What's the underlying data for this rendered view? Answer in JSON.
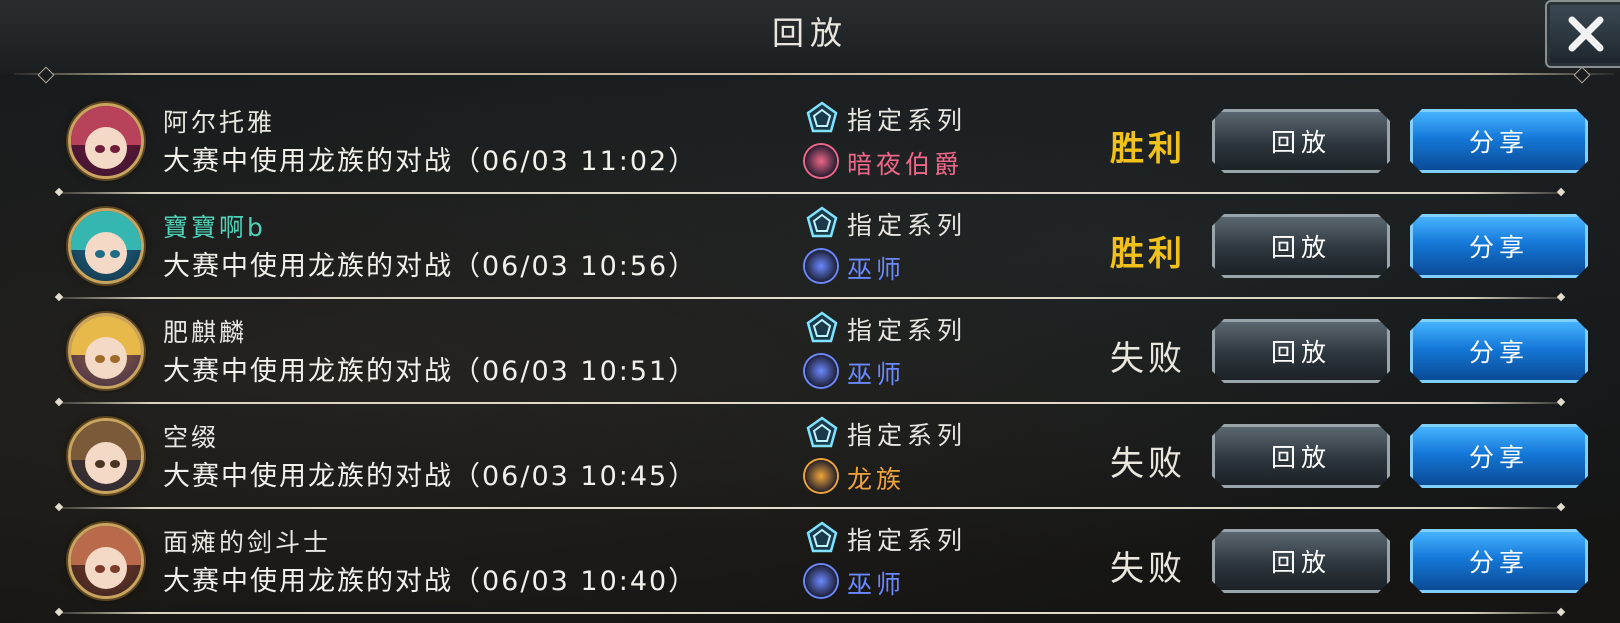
{
  "header": {
    "title": "回放"
  },
  "close": {
    "icon": "close-icon"
  },
  "buttons": {
    "replay": "回放",
    "share": "分享"
  },
  "colors": {
    "victory": "#f2c21a",
    "defeat": "#e9e6de",
    "name_highlight": "#4fd3b8"
  },
  "replays": [
    {
      "player": "阿尔托雅",
      "name_color": "default",
      "description": "大赛中使用龙族的对战（06/03 11:02）",
      "deck_type": "指定系列",
      "opponent_class": "暗夜伯爵",
      "class_icon": "nightmare-class-icon",
      "class_color": "#f0668a",
      "result": "胜利",
      "result_kind": "victory"
    },
    {
      "player": "寶寶啊b",
      "name_color": "teal",
      "description": "大赛中使用龙族的对战（06/03 10:56）",
      "deck_type": "指定系列",
      "opponent_class": "巫师",
      "class_icon": "runecraft-class-icon",
      "class_color": "#6a88ff",
      "result": "胜利",
      "result_kind": "victory"
    },
    {
      "player": "肥麒麟",
      "name_color": "default",
      "description": "大赛中使用龙族的对战（06/03 10:51）",
      "deck_type": "指定系列",
      "opponent_class": "巫师",
      "class_icon": "runecraft-class-icon",
      "class_color": "#6a88ff",
      "result": "失败",
      "result_kind": "defeat"
    },
    {
      "player": "空缀",
      "name_color": "default",
      "description": "大赛中使用龙族的对战（06/03 10:45）",
      "deck_type": "指定系列",
      "opponent_class": "龙族",
      "class_icon": "dragoncraft-class-icon",
      "class_color": "#f0a43c",
      "result": "失败",
      "result_kind": "defeat"
    },
    {
      "player": "面瘫的剑斗士",
      "name_color": "default",
      "description": "大赛中使用龙族的对战（06/03 10:40）",
      "deck_type": "指定系列",
      "opponent_class": "巫师",
      "class_icon": "runecraft-class-icon",
      "class_color": "#6a88ff",
      "result": "失败",
      "result_kind": "defeat"
    }
  ]
}
